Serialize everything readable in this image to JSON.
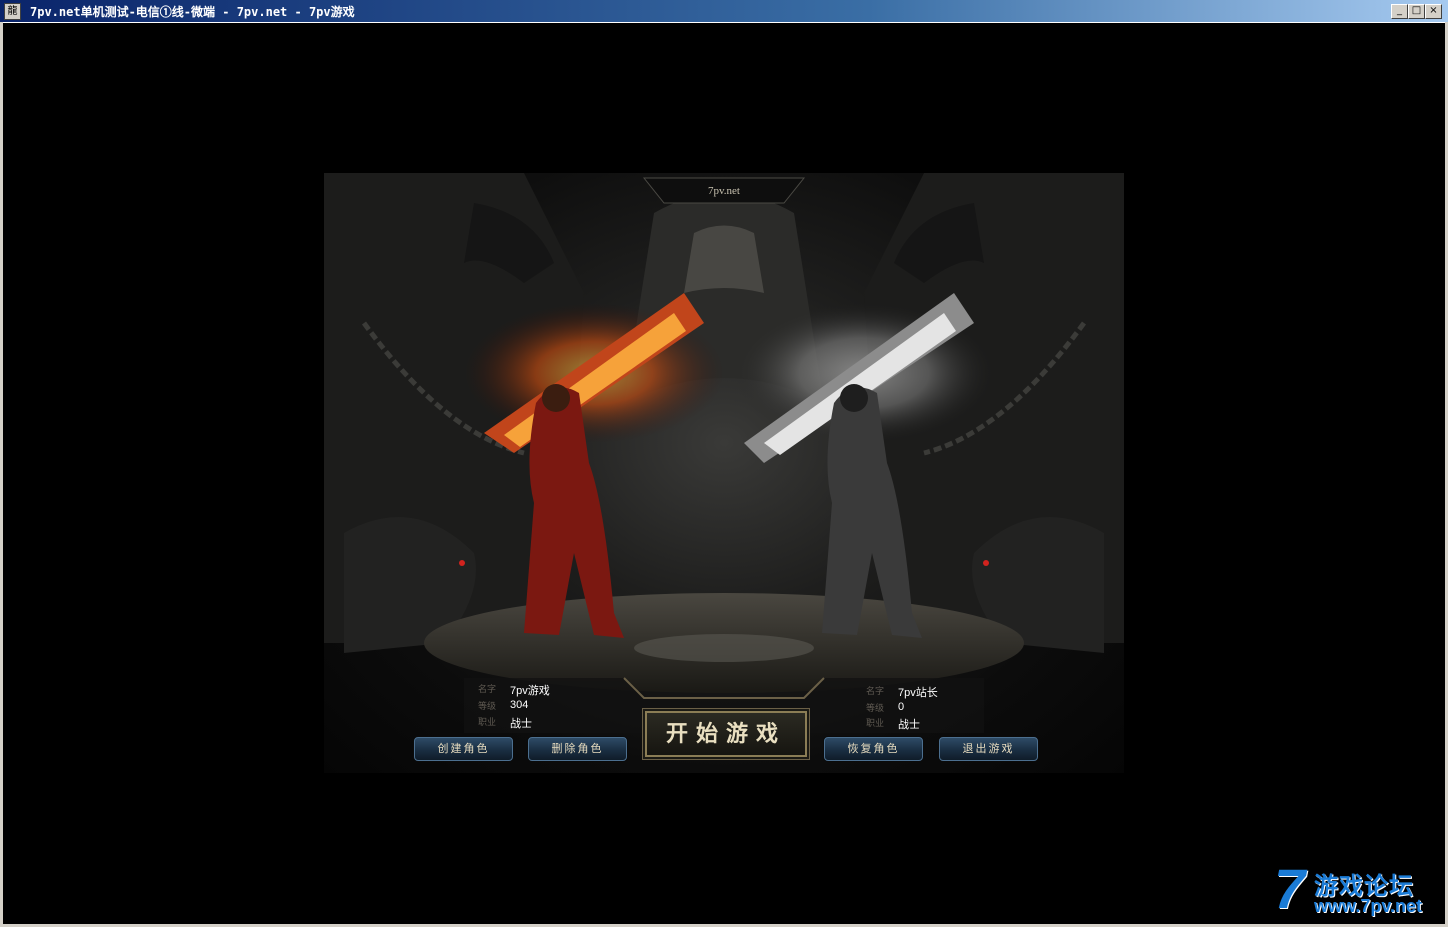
{
  "window": {
    "title": "7pv.net单机测试-电信①线-微端 - 7pv.net - 7pv游戏",
    "icon": "app-icon",
    "controls": {
      "minimize": "_",
      "maximize": "□",
      "close": "×"
    }
  },
  "game": {
    "server_label": "7pv.net",
    "characters": [
      {
        "name_label": "名字",
        "name": "7pv游戏",
        "level_label": "等级",
        "level": "304",
        "class_label": "职业",
        "class": "战士",
        "selected": true
      },
      {
        "name_label": "名字",
        "name": "7pv站长",
        "level_label": "等级",
        "level": "0",
        "class_label": "职业",
        "class": "战士",
        "selected": false
      }
    ],
    "buttons": {
      "create": "创建角色",
      "delete": "删除角色",
      "start": "开始游戏",
      "restore": "恢复角色",
      "exit": "退出游戏"
    }
  },
  "watermark": {
    "seven": "7",
    "cn": "游戏论坛",
    "url": "www.7pv.net"
  }
}
